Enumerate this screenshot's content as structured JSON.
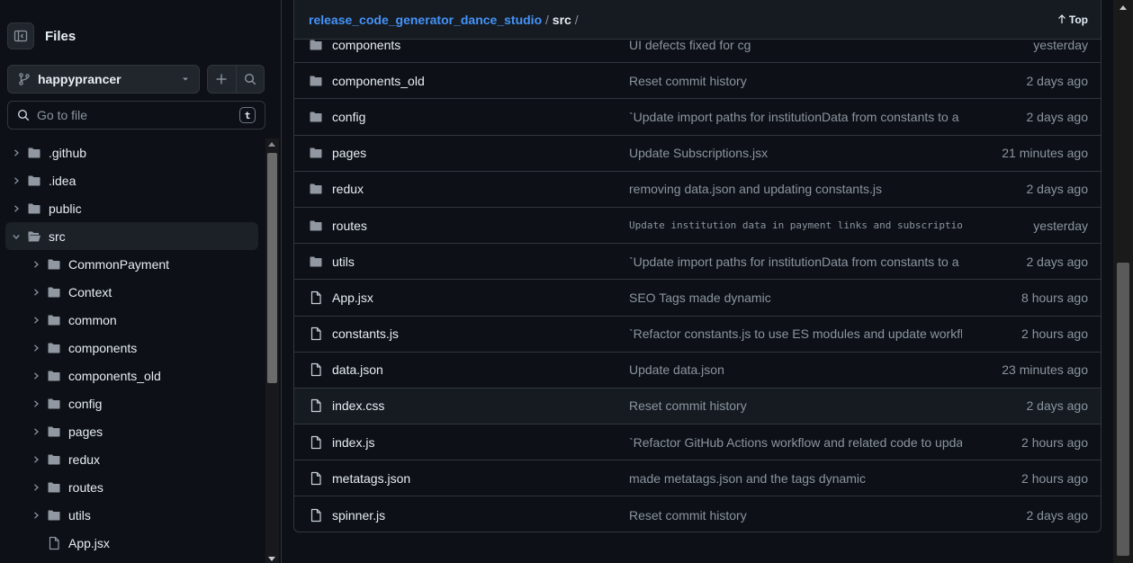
{
  "sidebar": {
    "title": "Files",
    "branch": "happyprancer",
    "search_placeholder": "Go to file",
    "search_shortcut": "t",
    "tree": [
      {
        "label": ".github",
        "type": "folder",
        "level": 0,
        "expanded": false
      },
      {
        "label": ".idea",
        "type": "folder",
        "level": 0,
        "expanded": false
      },
      {
        "label": "public",
        "type": "folder",
        "level": 0,
        "expanded": false
      },
      {
        "label": "src",
        "type": "folder",
        "level": 0,
        "expanded": true
      },
      {
        "label": "CommonPayment",
        "type": "folder",
        "level": 1,
        "expanded": false
      },
      {
        "label": "Context",
        "type": "folder",
        "level": 1,
        "expanded": false
      },
      {
        "label": "common",
        "type": "folder",
        "level": 1,
        "expanded": false
      },
      {
        "label": "components",
        "type": "folder",
        "level": 1,
        "expanded": false
      },
      {
        "label": "components_old",
        "type": "folder",
        "level": 1,
        "expanded": false
      },
      {
        "label": "config",
        "type": "folder",
        "level": 1,
        "expanded": false
      },
      {
        "label": "pages",
        "type": "folder",
        "level": 1,
        "expanded": false
      },
      {
        "label": "redux",
        "type": "folder",
        "level": 1,
        "expanded": false
      },
      {
        "label": "routes",
        "type": "folder",
        "level": 1,
        "expanded": false
      },
      {
        "label": "utils",
        "type": "folder",
        "level": 1,
        "expanded": false
      },
      {
        "label": "App.jsx",
        "type": "file",
        "level": 1,
        "expanded": false
      }
    ]
  },
  "breadcrumb": {
    "repo": "release_code_generator_dance_studio",
    "sep1": "/",
    "dir": "src",
    "sep2": "/",
    "top_label": "Top"
  },
  "files": [
    {
      "name": "components",
      "type": "folder",
      "message": "UI defects fixed for cg",
      "time": "yesterday",
      "mono": false
    },
    {
      "name": "components_old",
      "type": "folder",
      "message": "Reset commit history",
      "time": "2 days ago",
      "mono": false
    },
    {
      "name": "config",
      "type": "folder",
      "message": "`Update import paths for institutionData from constants to a ...",
      "time": "2 days ago",
      "mono": false
    },
    {
      "name": "pages",
      "type": "folder",
      "message": "Update Subscriptions.jsx",
      "time": "21 minutes ago",
      "mono": false
    },
    {
      "name": "redux",
      "type": "folder",
      "message": "removing data.json and updating constants.js",
      "time": "2 days ago",
      "mono": false
    },
    {
      "name": "routes",
      "type": "folder",
      "message": "Update institution data in payment links and subscription ...",
      "time": "yesterday",
      "mono": true
    },
    {
      "name": "utils",
      "type": "folder",
      "message": "`Update import paths for institutionData from constants to a ...",
      "time": "2 days ago",
      "mono": false
    },
    {
      "name": "App.jsx",
      "type": "file",
      "message": "SEO Tags made dynamic",
      "time": "8 hours ago",
      "mono": false
    },
    {
      "name": "constants.js",
      "type": "file",
      "message": "`Refactor constants.js to use ES modules and update workflow...",
      "time": "2 hours ago",
      "mono": false
    },
    {
      "name": "data.json",
      "type": "file",
      "message": "Update data.json",
      "time": "23 minutes ago",
      "mono": false
    },
    {
      "name": "index.css",
      "type": "file",
      "message": "Reset commit history",
      "time": "2 days ago",
      "mono": false,
      "highlight": true
    },
    {
      "name": "index.js",
      "type": "file",
      "message": "`Refactor GitHub Actions workflow and related code to updat...",
      "time": "2 hours ago",
      "mono": false
    },
    {
      "name": "metatags.json",
      "type": "file",
      "message": "made metatags.json and the tags dynamic",
      "time": "2 hours ago",
      "mono": false
    },
    {
      "name": "spinner.js",
      "type": "file",
      "message": "Reset commit history",
      "time": "2 days ago",
      "mono": false
    }
  ],
  "colors": {
    "background": "#0d1117",
    "panel": "#161b22",
    "border": "#30363d",
    "link": "#4493f8",
    "muted": "#8b949e",
    "text": "#e6edf3"
  }
}
